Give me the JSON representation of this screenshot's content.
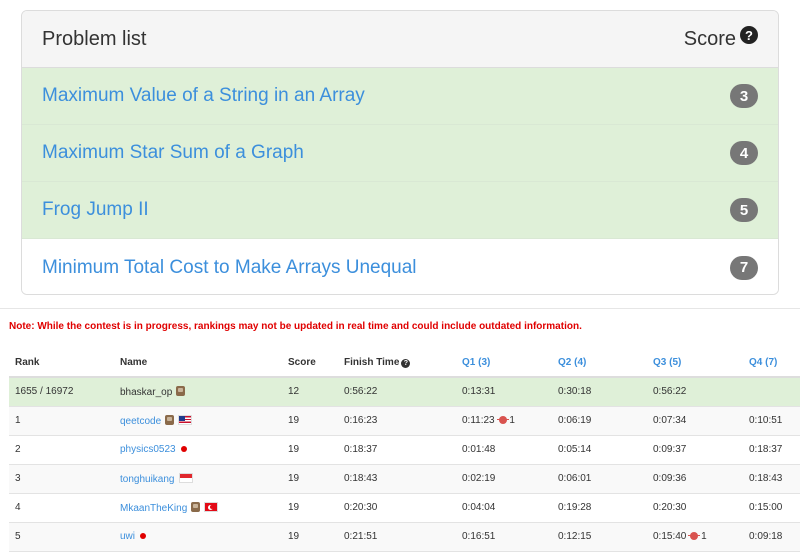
{
  "problem_list": {
    "title": "Problem list",
    "score_header": "Score",
    "help_glyph": "?",
    "problems": [
      {
        "title": "Maximum Value of a String in an Array",
        "score": "3",
        "solved": true
      },
      {
        "title": "Maximum Star Sum of a Graph",
        "score": "4",
        "solved": true
      },
      {
        "title": "Frog Jump II",
        "score": "5",
        "solved": true
      },
      {
        "title": "Minimum Total Cost to Make Arrays Unequal",
        "score": "7",
        "solved": false
      }
    ]
  },
  "ranking": {
    "note": "Note: While the contest is in progress, rankings may not be updated in real time and could include outdated information.",
    "columns": {
      "rank": "Rank",
      "name": "Name",
      "score": "Score",
      "finish_time": "Finish Time",
      "q1": "Q1 (3)",
      "q2": "Q2 (4)",
      "q3": "Q3 (5)",
      "q4": "Q4 (7)"
    },
    "help_glyph": "?",
    "rows": [
      {
        "rank": "1655 / 16972",
        "name": "bhaskar_op",
        "score": "12",
        "finish": "0:56:22",
        "q1": "0:13:31",
        "q1_penalty": "",
        "q2": "0:30:18",
        "q3": "0:56:22",
        "q3_penalty": "",
        "q4": ""
      },
      {
        "rank": "1",
        "name": "qeetcode",
        "score": "19",
        "finish": "0:16:23",
        "q1": "0:11:23",
        "q1_penalty": "1",
        "q2": "0:06:19",
        "q3": "0:07:34",
        "q3_penalty": "",
        "q4": "0:10:51"
      },
      {
        "rank": "2",
        "name": "physics0523",
        "score": "19",
        "finish": "0:18:37",
        "q1": "0:01:48",
        "q1_penalty": "",
        "q2": "0:05:14",
        "q3": "0:09:37",
        "q3_penalty": "",
        "q4": "0:18:37"
      },
      {
        "rank": "3",
        "name": "tonghuikang",
        "score": "19",
        "finish": "0:18:43",
        "q1": "0:02:19",
        "q1_penalty": "",
        "q2": "0:06:01",
        "q3": "0:09:36",
        "q3_penalty": "",
        "q4": "0:18:43"
      },
      {
        "rank": "4",
        "name": "MkaanTheKing",
        "score": "19",
        "finish": "0:20:30",
        "q1": "0:04:04",
        "q1_penalty": "",
        "q2": "0:19:28",
        "q3": "0:20:30",
        "q3_penalty": "",
        "q4": "0:15:00"
      },
      {
        "rank": "5",
        "name": "uwi",
        "score": "19",
        "finish": "0:21:51",
        "q1": "0:16:51",
        "q1_penalty": "",
        "q2": "0:12:15",
        "q3": "0:15:40",
        "q3_penalty": "1",
        "q4": "0:09:18"
      }
    ]
  },
  "colors": {
    "solved_bg": "#dff0d8",
    "link": "#3c8fdc",
    "badge": "#777777",
    "note": "#e00000"
  }
}
